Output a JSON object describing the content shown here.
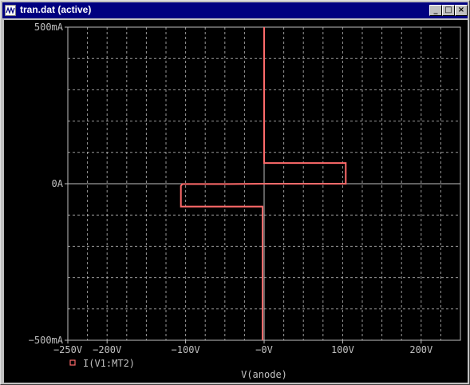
{
  "window": {
    "title": "tran.dat (active)",
    "buttons": {
      "minimize": "_",
      "maximize": "□",
      "close": "×"
    }
  },
  "colors": {
    "plot_bg": "#000000",
    "axis": "#c0c0c0",
    "grid": "#c0c0c0",
    "trace": "#ff6b6b"
  },
  "chart_data": {
    "type": "line",
    "title": "",
    "xlabel": "V(anode)",
    "ylabel": "",
    "xlim": [
      -250,
      250
    ],
    "ylim": [
      -500,
      500
    ],
    "x_unit": "V",
    "y_unit": "mA",
    "x_ticks": [
      {
        "value": -250,
        "label": "−250V"
      },
      {
        "value": -200,
        "label": "−200V"
      },
      {
        "value": -100,
        "label": "−100V"
      },
      {
        "value": 0,
        "label": "−0V"
      },
      {
        "value": 100,
        "label": "100V"
      },
      {
        "value": 200,
        "label": "200V"
      }
    ],
    "y_ticks": [
      {
        "value": 500,
        "label": "500mA"
      },
      {
        "value": 0,
        "label": "0A"
      },
      {
        "value": -500,
        "label": "−500mA"
      }
    ],
    "grid": true,
    "legend_position": "bottom-left",
    "series": [
      {
        "name": "I(V1:MT2)",
        "marker": "square",
        "x": [
          0,
          0,
          104,
          104,
          0,
          -44,
          -104,
          -106,
          -106,
          -2,
          -2
        ],
        "y": [
          500,
          66,
          66,
          0,
          0,
          -1,
          -1,
          -7,
          -73,
          -73,
          -500
        ]
      }
    ]
  }
}
